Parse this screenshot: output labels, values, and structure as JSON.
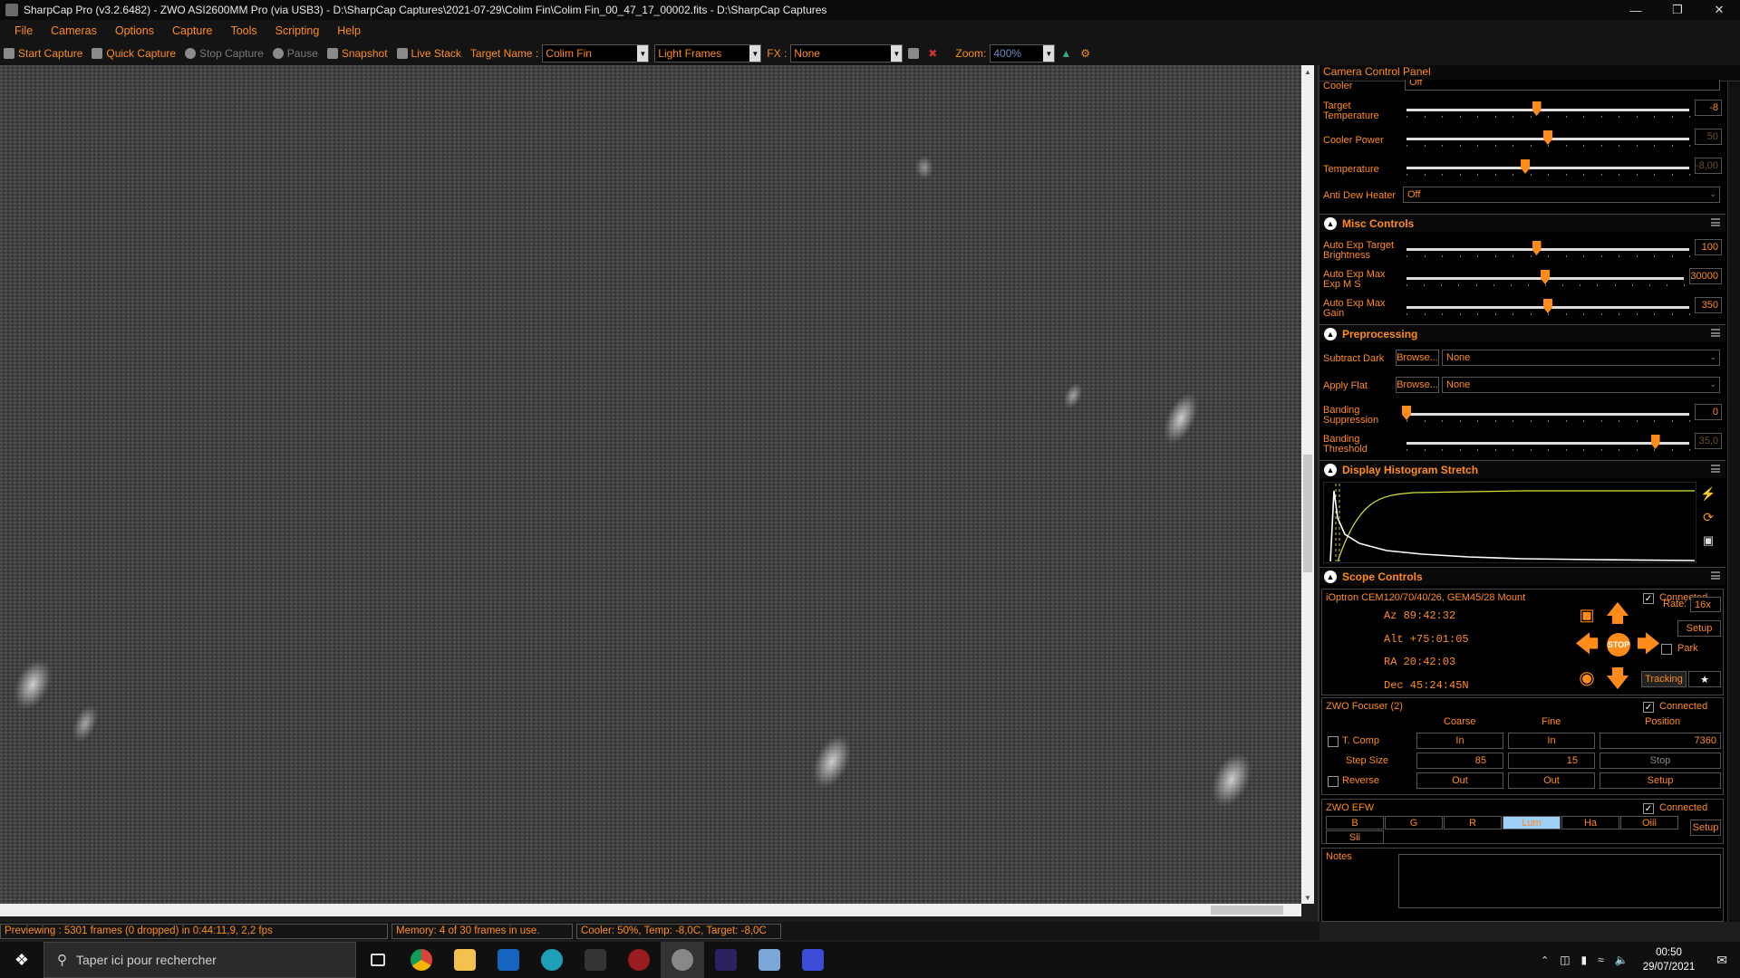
{
  "window": {
    "title": "SharpCap Pro (v3.2.6482) - ZWO ASI2600MM Pro (via USB3) - D:\\SharpCap Captures\\2021-07-29\\Colim Fin\\Colim Fin_00_47_17_00002.fits - D:\\SharpCap Captures"
  },
  "menu": [
    "File",
    "Cameras",
    "Options",
    "Capture",
    "Tools",
    "Scripting",
    "Help"
  ],
  "toolbar": {
    "start_capture": "Start Capture",
    "quick_capture": "Quick Capture",
    "stop_capture": "Stop Capture",
    "pause": "Pause",
    "snapshot": "Snapshot",
    "live_stack": "Live Stack",
    "target_name_label": "Target Name :",
    "target_name_value": "Colim Fin",
    "frame_type": "Light Frames",
    "fx_label": "FX :",
    "fx_value": "None",
    "zoom_label": "Zoom:",
    "zoom_value": "400%"
  },
  "status": {
    "preview": "Previewing : 5301 frames (0 dropped) in 0:44:11,9, 2,2 fps",
    "memory": "Memory: 4 of 30 frames in use.",
    "cooler": "Cooler: 50%, Temp: -8,0C, Target: -8,0C"
  },
  "panel": {
    "title": "Camera Control Panel",
    "cooler_label": "Cooler",
    "cooler_value": "Off",
    "target_temp_label": "Target Temperature",
    "target_temp_value": "-8",
    "target_temp_level": 0.46,
    "cooler_power_label": "Cooler Power",
    "cooler_power_value": "50",
    "cooler_power_level": 0.5,
    "temperature_label": "Temperature",
    "temperature_value": "-8,00",
    "temperature_level": 0.42,
    "anti_dew_label": "Anti Dew Heater",
    "anti_dew_value": "Off",
    "misc": {
      "title": "Misc Controls",
      "auto_exp_target_label": "Auto Exp Target Brightness",
      "auto_exp_target_value": "100",
      "auto_exp_target_level": 0.46,
      "auto_exp_max_ms_label": "Auto Exp Max Exp M S",
      "auto_exp_max_ms_value": "30000",
      "auto_exp_max_ms_level": 0.5,
      "auto_exp_max_gain_label": "Auto Exp Max Gain",
      "auto_exp_max_gain_value": "350",
      "auto_exp_max_gain_level": 0.5
    },
    "pre": {
      "title": "Preprocessing",
      "subtract_dark_label": "Subtract Dark",
      "apply_flat_label": "Apply Flat",
      "browse": "Browse...",
      "dark_value": "None",
      "flat_value": "None",
      "banding_supp_label": "Banding Suppression",
      "banding_supp_value": "0",
      "banding_supp_level": 0.0,
      "banding_thresh_label": "Banding Threshold",
      "banding_thresh_value": "35,0",
      "banding_thresh_level": 0.88
    },
    "hist": {
      "title": "Display Histogram Stretch"
    },
    "scope": {
      "title": "Scope Controls",
      "mount": "iOptron CEM120/70/40/26, GEM45/28 Mount",
      "connected": "Connected",
      "az": "Az  89:42:32",
      "alt": "Alt +75:01:05",
      "ra": "RA  20:42:03",
      "dec": "Dec 45:24:45N",
      "rate_label": "Rate:",
      "rate_value": "16x",
      "setup": "Setup",
      "park": "Park",
      "tracking": "Tracking",
      "stop": "STOP"
    },
    "focuser": {
      "title": "ZWO Focuser (2)",
      "connected": "Connected",
      "coarse": "Coarse",
      "fine": "Fine",
      "position": "Position",
      "tcomp": "T. Comp",
      "in": "In",
      "position_value": "7360",
      "step_size": "Step Size",
      "coarse_step": "85",
      "fine_step": "15",
      "stop": "Stop",
      "reverse": "Reverse",
      "out": "Out",
      "setup": "Setup"
    },
    "efw": {
      "title": "ZWO EFW",
      "connected": "Connected",
      "filters": [
        "B",
        "G",
        "R",
        "Lum",
        "Ha",
        "Oiii"
      ],
      "filter_sii": "Sii",
      "setup": "Setup",
      "active": "Lum"
    },
    "notes_label": "Notes"
  },
  "taskbar": {
    "search_placeholder": "Taper ici pour rechercher",
    "time": "00:50",
    "date": "29/07/2021"
  }
}
